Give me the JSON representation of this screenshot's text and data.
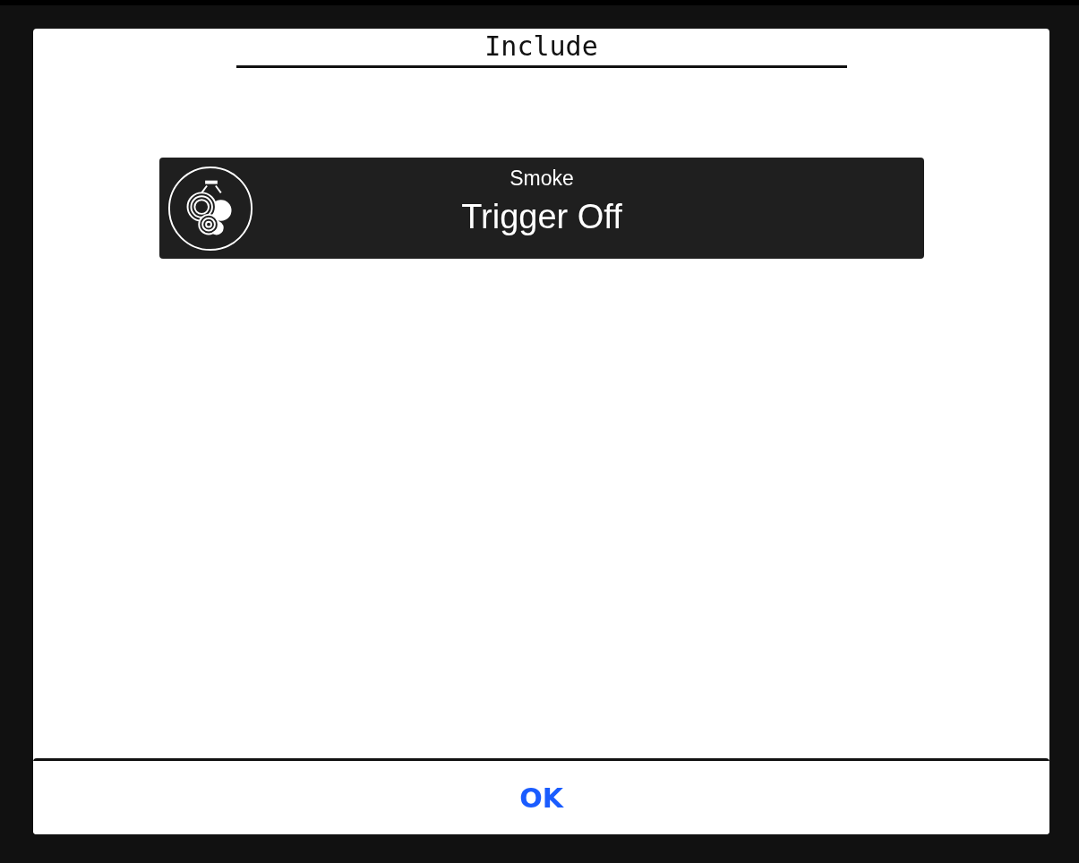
{
  "dialog": {
    "title": "Include",
    "items": [
      {
        "kind": "smoke",
        "name": "Smoke",
        "action": "Trigger Off"
      }
    ],
    "buttons": [
      "OK"
    ]
  }
}
